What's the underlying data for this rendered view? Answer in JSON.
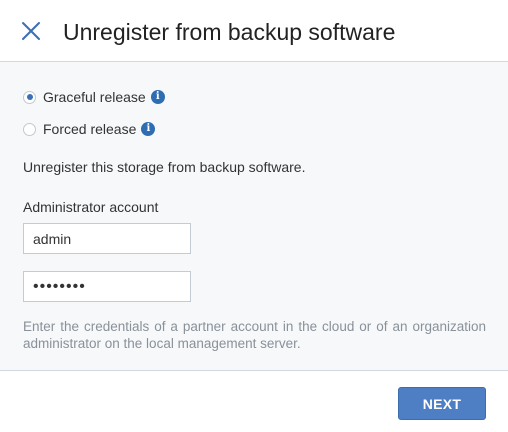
{
  "dialog": {
    "title": "Unregister from backup software",
    "close_icon": "close-icon"
  },
  "release_options": [
    {
      "label": "Graceful release",
      "selected": true,
      "info_icon": "info-icon"
    },
    {
      "label": "Forced release",
      "selected": false,
      "info_icon": "info-icon"
    }
  ],
  "description": "Unregister this storage from backup software.",
  "account": {
    "label": "Administrator account",
    "username_value": "admin",
    "password_value": "••••••••"
  },
  "hint": "Enter the credentials of a partner account in the cloud or of an organization administrator on the local management server.",
  "footer": {
    "next_label": "NEXT"
  },
  "colors": {
    "accent": "#3b6fb6",
    "button": "#4e7fc4",
    "body_background": "#f6f8fa",
    "hint_text": "#8a9199"
  }
}
